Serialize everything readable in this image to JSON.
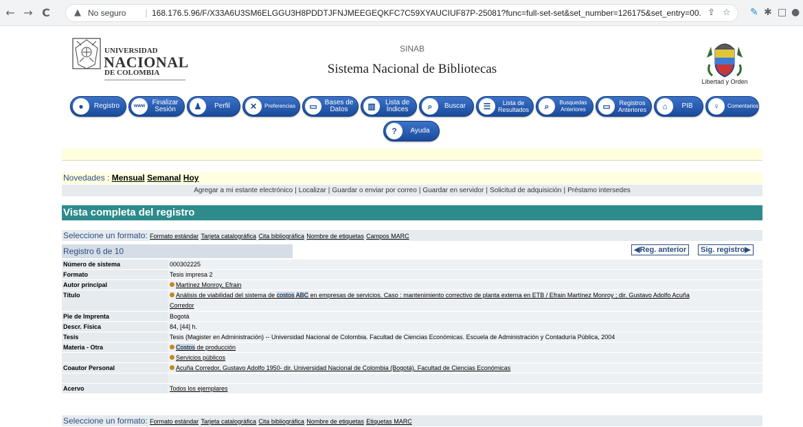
{
  "browser": {
    "back_icon": "←",
    "forward_icon": "→",
    "reload_icon": "C",
    "security_label": "No seguro",
    "url": "168.176.5.96/F/X33A6U3SM6ELGGU3H8PDDTJFNJMEEGEQKFC7C59XYAUCIUF87P-25081?func=full-set-set&set_number=126175&set_entry=00...",
    "ext_icons": [
      "share-icon",
      "star-icon",
      "feather-icon",
      "puzzle-icon",
      "sidepanel-icon",
      "profile-icon"
    ]
  },
  "header": {
    "logo_line1": "UNIVERSIDAD",
    "logo_line2": "NACIONAL",
    "logo_line3": "DE COLOMBIA",
    "sinab": "SINAB",
    "title": "Sistema Nacional de Bibliotecas",
    "libertad": "Libertad y Orden"
  },
  "nav_buttons": [
    {
      "label": "Registro",
      "icon": "user-icon"
    },
    {
      "label": "Finalizar Sesión",
      "icon": "www-icon"
    },
    {
      "label": "Perfil",
      "icon": "person-icon"
    },
    {
      "label": "Preferencias",
      "icon": "tools-icon"
    },
    {
      "label": "Bases de Datos",
      "icon": "database-icon"
    },
    {
      "label": "Lista de Índices",
      "icon": "book-icon"
    },
    {
      "label": "Buscar",
      "icon": "search-icon"
    },
    {
      "label": "Lista de Resultados",
      "icon": "list-icon"
    },
    {
      "label": "Busquedas Anteriores",
      "icon": "search-history-icon"
    },
    {
      "label": "Registros Anteriores",
      "icon": "records-icon"
    },
    {
      "label": "PIB",
      "icon": "home-icon"
    },
    {
      "label": "Comentarios",
      "icon": "bulb-icon"
    }
  ],
  "help_button": {
    "label": "Ayuda",
    "icon": "help-icon"
  },
  "novedades": {
    "label": "Novedades :",
    "links": [
      "Mensual",
      "Semanal",
      "Hoy"
    ]
  },
  "actions": [
    "Agregar a mi estante electrónico",
    "Localizar",
    "Guardar o enviar por correo",
    "Guardar en servidor",
    "Solicitud de adquisición",
    "Préstamo intersedes"
  ],
  "vista_title": "Vista completa del registro",
  "format_select": {
    "label": "Seleccione un formato:",
    "links_top": [
      "Formato estándar",
      "Tarjeta catalográfica",
      "Cita bibliográfica",
      "Nombre de etiquetas",
      "Campos MARC"
    ],
    "links_bottom": [
      "Formato estándar",
      "Tarjeta catalográfica",
      "Cita bibliográfica",
      "Nombre de etiquetas",
      "Etiquetas MARC"
    ]
  },
  "registro": {
    "label": "Registro 6 de 10",
    "prev": "◀Reg. anterior",
    "next": "Sig. registro▶"
  },
  "record": {
    "numero_label": "Número de sistema",
    "numero": "000302225",
    "formato_label": "Formato",
    "formato": "Tesis impresa 2",
    "autor_label": "Autor principal",
    "autor": "Martínez Monroy, Efrain",
    "titulo_label": "Título",
    "titulo_a": "Análisis de viabilidad del sistema de ",
    "titulo_b": "costos",
    "titulo_c": " ",
    "titulo_d": "ABC",
    "titulo_e": " en empresas de servicios. Caso : mantenimiento correctivo de planta externa en ETB / Efrain Martínez Monroy ; dir. Gustavo Adolfo Acuña",
    "titulo_f": "Corredor",
    "pie_label": "Pie de Imprenta",
    "pie": "Bogotá",
    "descr_label": "Descr. Física",
    "descr": "84, [44] h.",
    "tesis_label": "Tesis",
    "tesis": "Tesis (Magister en Administración) -- Universidad Nacional de Colombia. Facultad de Ciencias Económicas. Escuela de Administración y Contaduría Pública, 2004",
    "materia_label": "Materia - Otra",
    "materia1_a": "Costos",
    "materia1_b": " de producción",
    "materia2": "Servicios públicos",
    "coautor_label": "Coautor Personal",
    "coautor": "Acuña Corredor, Gustavo Adolfo 1950- dir. Universidad Nacional de Colombia (Bogotá). Facultad de Ciencias Económicas",
    "acervo_label": "Acervo",
    "acervo": "Todos los ejemplares"
  }
}
